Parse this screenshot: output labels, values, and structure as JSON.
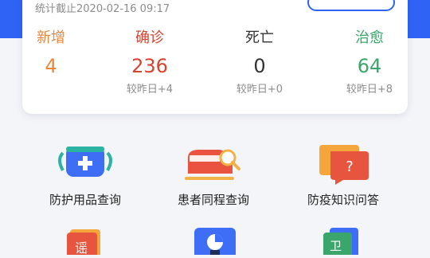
{
  "header": {
    "updated_at": "统计截止2020-02-16 09:17"
  },
  "stats": [
    {
      "label": "新增",
      "value": "4",
      "delta": "",
      "color": "#e8873a"
    },
    {
      "label": "确诊",
      "value": "236",
      "delta": "较昨日+4",
      "color": "#d9432f"
    },
    {
      "label": "死亡",
      "value": "0",
      "delta": "较昨日+0",
      "color": "#333333"
    },
    {
      "label": "治愈",
      "value": "64",
      "delta": "较昨日+8",
      "color": "#3aa66b"
    }
  ],
  "services": [
    {
      "label": "防护用品查询",
      "icon": "mask-icon"
    },
    {
      "label": "患者同程查询",
      "icon": "train-search-icon"
    },
    {
      "label": "防疫知识问答",
      "icon": "question-bubble-icon"
    }
  ],
  "services_row2": [
    {
      "label": "",
      "icon": "rumor-book-icon",
      "icon_text": "谣"
    },
    {
      "label": "",
      "icon": "chart-report-icon"
    },
    {
      "label": "",
      "icon": "health-document-icon",
      "icon_text": "卫"
    }
  ]
}
